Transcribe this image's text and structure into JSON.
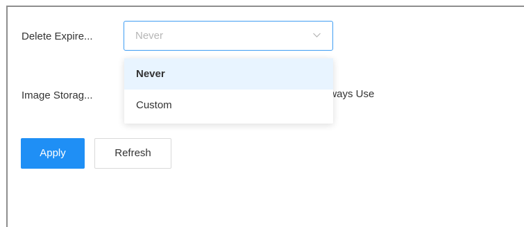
{
  "form": {
    "delete_expired_label": "Delete Expire...",
    "delete_expired_value": "Never",
    "image_storage_label": "Image Storag...",
    "image_storage_value_partial": "Always Use"
  },
  "dropdown": {
    "options": [
      {
        "label": "Never",
        "selected": true
      },
      {
        "label": "Custom",
        "selected": false
      }
    ]
  },
  "actions": {
    "apply_label": "Apply",
    "refresh_label": "Refresh"
  },
  "icons": {
    "select_arrow": "chevron-down-icon"
  },
  "colors": {
    "accent": "#1f8ff5",
    "select_border_focus": "#3f9df3",
    "option_selected_bg": "#e8f4ff",
    "placeholder_text": "#b6b6b6"
  }
}
